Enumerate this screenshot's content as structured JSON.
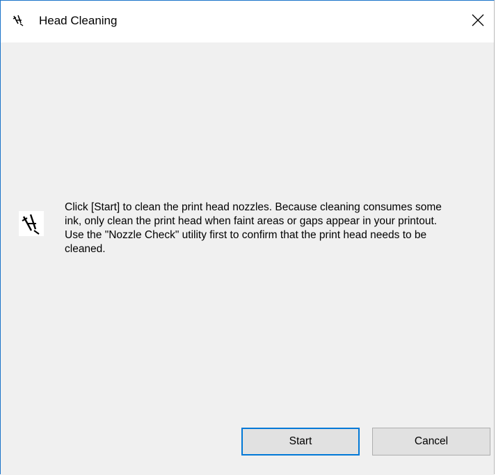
{
  "window": {
    "title": "Head Cleaning",
    "title_icon": "printer-head-icon",
    "close_icon": "close-icon"
  },
  "dialog": {
    "icon": "printer-head-icon",
    "message": "Click [Start] to clean the print head nozzles. Because cleaning consumes some ink, only clean the print head when faint areas or gaps appear in your printout. Use the \"Nozzle Check\" utility first to confirm that the print head needs to be cleaned."
  },
  "buttons": {
    "start_label": "Start",
    "cancel_label": "Cancel"
  },
  "colors": {
    "accent": "#0078d7",
    "window_border": "#1a73c9",
    "body_background": "#f0f0f0",
    "button_background": "#e1e1e1"
  }
}
